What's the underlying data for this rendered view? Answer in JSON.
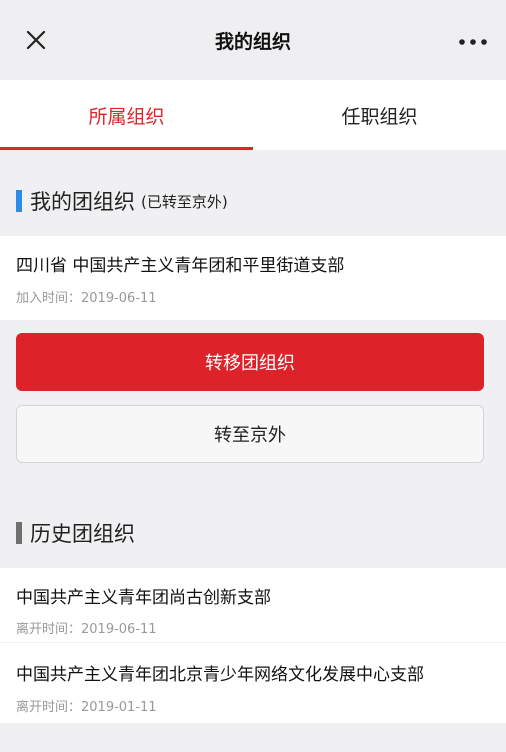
{
  "navbar": {
    "title": "我的组织",
    "close_icon": "close-icon",
    "more_icon": "more-icon"
  },
  "tabs": [
    {
      "label": "所属组织",
      "active": true
    },
    {
      "label": "任职组织",
      "active": false
    }
  ],
  "my_league": {
    "title": "我的团组织",
    "note": "(已转至京外)",
    "org": {
      "name": "四川省  中国共产主义青年团和平里街道支部",
      "join_time": "加入时间：2019-06-11"
    },
    "transfer_button": "转移团组织",
    "out_button": "转至京外"
  },
  "history": {
    "title": "历史团组织",
    "items": [
      {
        "name": "中国共产主义青年团尚古创新支部",
        "leave_time": "离开时间：2019-06-11"
      },
      {
        "name": "中国共产主义青年团北京青少年网络文化发展中心支部",
        "leave_time": "离开时间：2019-01-11"
      }
    ]
  },
  "colors": {
    "accent_red": "#e0242c",
    "accent_blue": "#2a8ce8",
    "meta_gray": "#999999"
  }
}
